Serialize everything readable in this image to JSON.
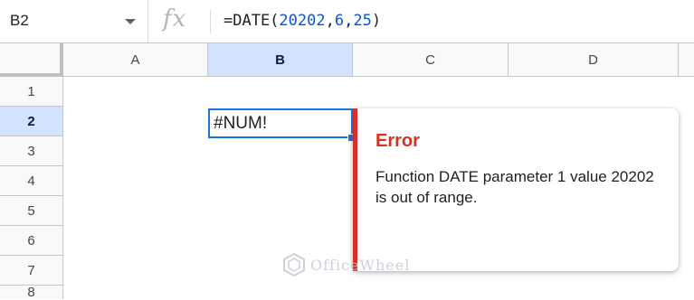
{
  "namebox": {
    "value": "B2"
  },
  "formula": {
    "prefix": "=DATE(",
    "arg1": "20202",
    "sep1": ",",
    "arg2": "6",
    "sep2": ",",
    "arg3": "25",
    "suffix": ")"
  },
  "columns": [
    "A",
    "B",
    "C",
    "D"
  ],
  "rows": [
    "1",
    "2",
    "3",
    "4",
    "5",
    "6",
    "7",
    "8"
  ],
  "active_cell": {
    "value": "#NUM!"
  },
  "error": {
    "title": "Error",
    "message": "Function DATE parameter 1 value 20202 is out of range."
  },
  "watermark": {
    "text": "OfficeWheel"
  },
  "colors": {
    "selection": "#1a73e8",
    "error": "#d93025",
    "header_selected": "#d3e3fd"
  }
}
